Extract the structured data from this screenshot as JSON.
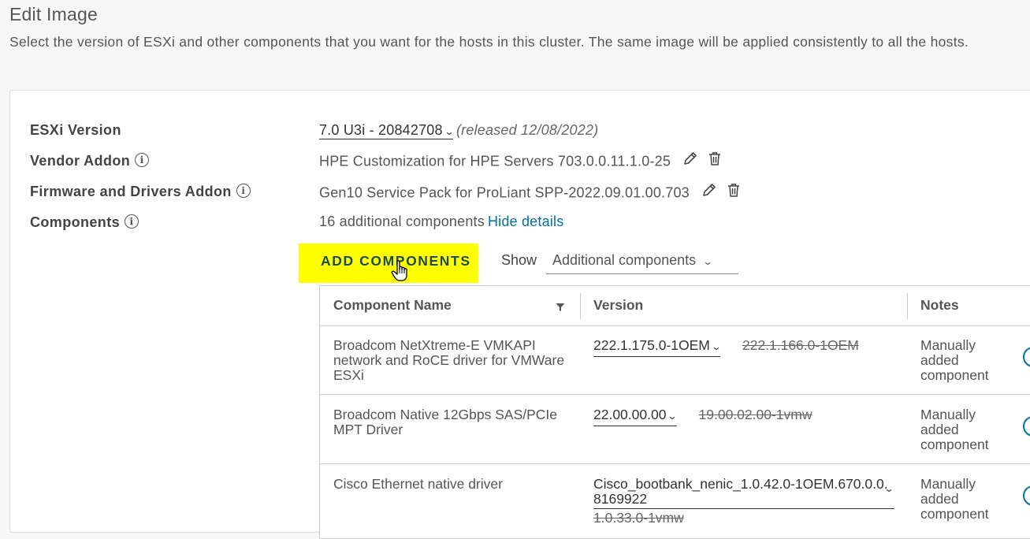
{
  "page": {
    "title": "Edit Image",
    "description": "Select the version of ESXi and other components that you want for the hosts in this cluster. The same image will be applied consistently to all the hosts."
  },
  "fields": {
    "esxi_version": {
      "label": "ESXi Version",
      "value": "7.0 U3i - 20842708",
      "released": "(released 12/08/2022)"
    },
    "vendor_addon": {
      "label": "Vendor Addon",
      "value": "HPE Customization for HPE Servers 703.0.0.11.1.0-25"
    },
    "firmware_addon": {
      "label": "Firmware and Drivers Addon",
      "value": "Gen10 Service Pack for ProLiant SPP-2022.09.01.00.703"
    },
    "components": {
      "label": "Components",
      "count_text": "16 additional components",
      "toggle_link": "Hide details"
    }
  },
  "toolbar": {
    "add_components_label": "ADD COMPONENTS",
    "show_label": "Show",
    "show_selected": "Additional components"
  },
  "table": {
    "headers": {
      "name": "Component Name",
      "version": "Version",
      "notes": "Notes"
    },
    "rows": [
      {
        "name": "Broadcom NetXtreme-E VMKAPI network and RoCE driver for VMWare ESXi",
        "version": "222.1.175.0-1OEM",
        "old_version": "222.1.166.0-1OEM",
        "notes": "Manually added component"
      },
      {
        "name": "Broadcom Native 12Gbps SAS/PCIe MPT Driver",
        "version": "22.00.00.00",
        "old_version": "19.00.02.00-1vmw",
        "notes": "Manually added component"
      },
      {
        "name": "Cisco Ethernet native driver",
        "version": "Cisco_bootbank_nenic_1.0.42.0-1OEM.670.0.0.8169922",
        "old_version": "1.0.33.0-1vmw",
        "notes": "Manually added component"
      }
    ]
  },
  "colors": {
    "link": "#0072a3",
    "highlight": "#ffff00"
  }
}
